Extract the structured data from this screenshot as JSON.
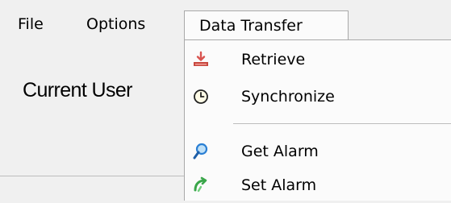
{
  "menubar": {
    "items": [
      {
        "label": "File"
      },
      {
        "label": "Options"
      },
      {
        "label": "Data Transfer"
      }
    ]
  },
  "main": {
    "current_user_label": "Current User"
  },
  "dropdown": {
    "items": [
      {
        "label": "Retrieve",
        "icon": "download-arrow-icon"
      },
      {
        "label": "Synchronize",
        "icon": "clock-icon"
      },
      {
        "label": "Get Alarm",
        "icon": "magnifier-icon"
      },
      {
        "label": "Set Alarm",
        "icon": "green-arrow-icon"
      }
    ]
  },
  "colors": {
    "menubar_bg": "#f0f0f0",
    "dropdown_bg": "#fbfbfb",
    "border": "#a9a9a9",
    "retrieve_icon": "#d9534f",
    "get_alarm_icon": "#2a7fd4",
    "set_alarm_icon": "#3aa64a"
  }
}
